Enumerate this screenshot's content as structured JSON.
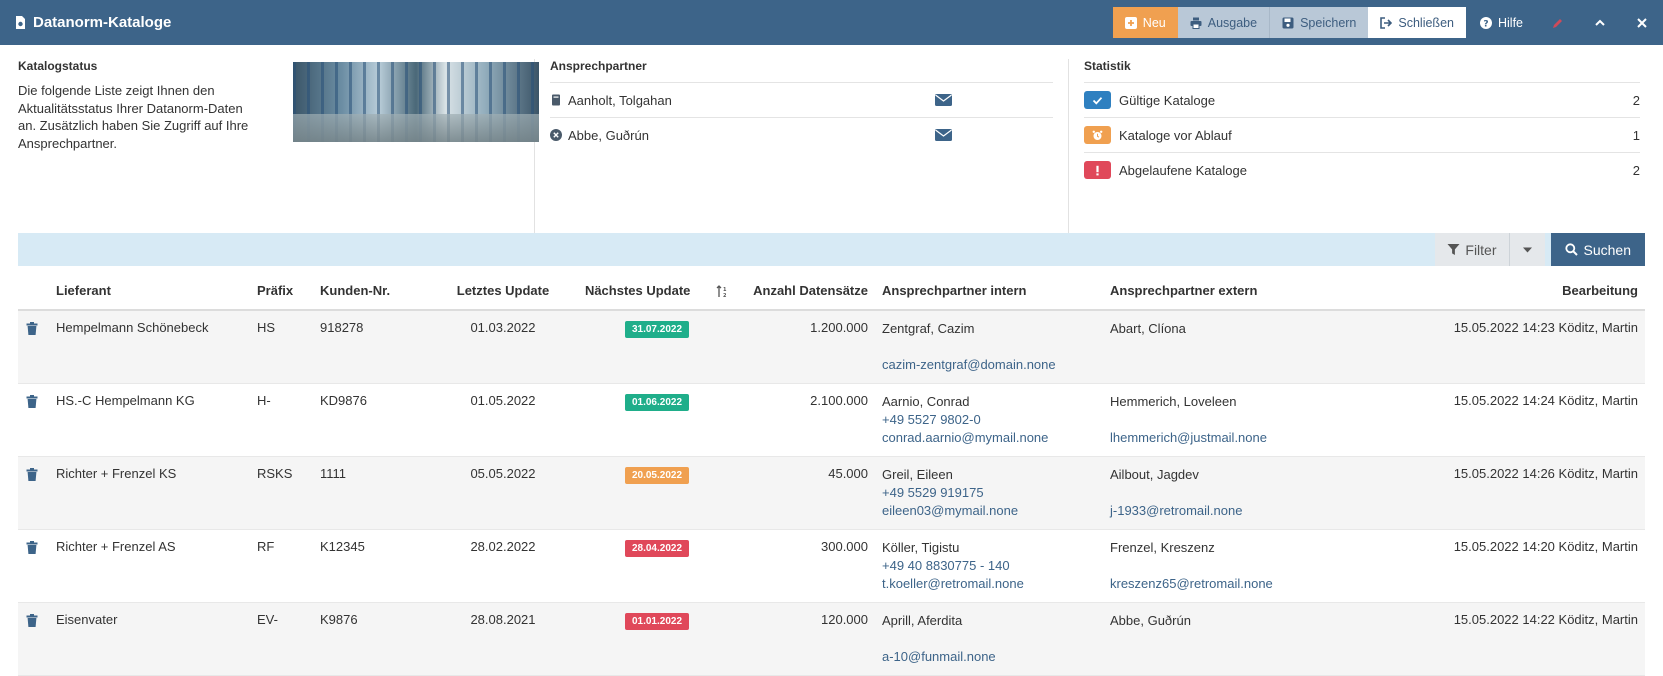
{
  "header": {
    "title": "Datanorm-Kataloge",
    "buttons": {
      "neu": "Neu",
      "ausgabe": "Ausgabe",
      "speichern": "Speichern",
      "schliessen": "Schließen",
      "hilfe": "Hilfe"
    }
  },
  "catalog_status": {
    "title": "Katalogstatus",
    "text": "Die folgende Liste zeigt Ihnen den Aktualitätsstatus Ihrer Datanorm-Daten an. Zusätzlich haben Sie Zugriff auf Ihre Ansprechpartner."
  },
  "contacts": {
    "title": "Ansprechpartner",
    "items": [
      {
        "name": "Aanholt, Tolgahan",
        "icon": "book-icon"
      },
      {
        "name": "Abbe, Guðrún",
        "icon": "circle-x-icon"
      }
    ]
  },
  "stats": {
    "title": "Statistik",
    "items": [
      {
        "label": "Gültige Kataloge",
        "value": "2",
        "color": "#2f80c0",
        "icon": "check-icon"
      },
      {
        "label": "Kataloge vor Ablauf",
        "value": "1",
        "color": "#f0a050",
        "icon": "alarm-clock-icon"
      },
      {
        "label": "Abgelaufene Kataloge",
        "value": "2",
        "color": "#e0485a",
        "icon": "exclamation-icon"
      }
    ]
  },
  "filterbar": {
    "filter_label": "Filter",
    "search_label": "Suchen"
  },
  "table": {
    "columns": {
      "lieferant": "Lieferant",
      "praefix": "Präfix",
      "kundennr": "Kunden-Nr.",
      "letztes": "Letztes Update",
      "naechstes": "Nächstes Update",
      "anzahl": "Anzahl Datensätze",
      "intern": "Ansprechpartner intern",
      "extern": "Ansprechpartner extern",
      "bearbeitung": "Bearbeitung"
    },
    "rows": [
      {
        "lieferant": "Hempelmann Schönebeck",
        "praefix": "HS",
        "kundennr": "918278",
        "letztes": "01.03.2022",
        "naechstes": "31.07.2022",
        "badge_color": "#1fae8a",
        "anzahl": "1.200.000",
        "intern_name": "Zentgraf, Cazim",
        "intern_phone": "",
        "intern_mail": "cazim-zentgraf@domain.none",
        "extern_name": "Abart, Clíona",
        "extern_mail": "",
        "bearbeitung": "15.05.2022 14:23 Köditz, Martin"
      },
      {
        "lieferant": "HS.-C Hempelmann KG",
        "praefix": "H-",
        "kundennr": "KD9876",
        "letztes": "01.05.2022",
        "naechstes": "01.06.2022",
        "badge_color": "#1fae8a",
        "anzahl": "2.100.000",
        "intern_name": "Aarnio, Conrad",
        "intern_phone": "+49 5527 9802-0",
        "intern_mail": "conrad.aarnio@mymail.none",
        "extern_name": "Hemmerich, Loveleen",
        "extern_mail": "lhemmerich@justmail.none",
        "bearbeitung": "15.05.2022 14:24 Köditz, Martin"
      },
      {
        "lieferant": "Richter + Frenzel KS",
        "praefix": "RSKS",
        "kundennr": "1111",
        "letztes": "05.05.2022",
        "naechstes": "20.05.2022",
        "badge_color": "#f0a050",
        "anzahl": "45.000",
        "intern_name": "Greil, Eileen",
        "intern_phone": "+49 5529 919175",
        "intern_mail": "eileen03@mymail.none",
        "extern_name": "Ailbout, Jagdev",
        "extern_mail": "j-1933@retromail.none",
        "bearbeitung": "15.05.2022 14:26 Köditz, Martin"
      },
      {
        "lieferant": "Richter + Frenzel AS",
        "praefix": "RF",
        "kundennr": "K12345",
        "letztes": "28.02.2022",
        "naechstes": "28.04.2022",
        "badge_color": "#e0485a",
        "anzahl": "300.000",
        "intern_name": "Köller, Tigistu",
        "intern_phone": "+49 40 8830775 - 140",
        "intern_mail": "t.koeller@retromail.none",
        "extern_name": "Frenzel, Kreszenz",
        "extern_mail": "kreszenz65@retromail.none",
        "bearbeitung": "15.05.2022 14:20 Köditz, Martin"
      },
      {
        "lieferant": "Eisenvater",
        "praefix": "EV-",
        "kundennr": "K9876",
        "letztes": "28.08.2021",
        "naechstes": "01.01.2022",
        "badge_color": "#e0485a",
        "anzahl": "120.000",
        "intern_name": "Aprill, Aferdita",
        "intern_phone": "",
        "intern_mail": "a-10@funmail.none",
        "extern_name": "Abbe, Guðrún",
        "extern_mail": "",
        "bearbeitung": "15.05.2022 14:22 Köditz, Martin"
      }
    ]
  }
}
